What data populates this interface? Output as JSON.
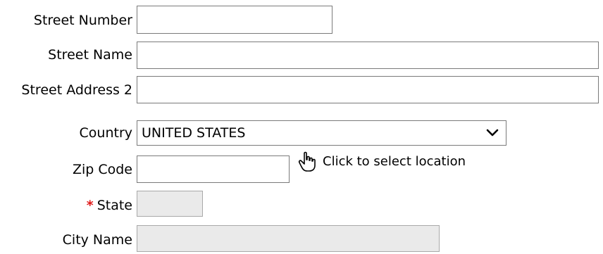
{
  "form": {
    "street_number": {
      "label": "Street Number",
      "value": ""
    },
    "street_name": {
      "label": "Street Name",
      "value": ""
    },
    "street_address_2": {
      "label": "Street Address 2",
      "value": ""
    },
    "country": {
      "label": "Country",
      "selected": "UNITED STATES"
    },
    "zip_code": {
      "label": "Zip Code",
      "value": ""
    },
    "location_link": {
      "label": "Click to select location",
      "icon": "hand-pointer-icon"
    },
    "state": {
      "required_marker": "*",
      "label": "State",
      "value": ""
    },
    "city_name": {
      "label": "City Name",
      "value": ""
    }
  },
  "colors": {
    "required": "#e01919",
    "disabled_bg": "#eaeaea",
    "border": "#7a7a7a"
  }
}
